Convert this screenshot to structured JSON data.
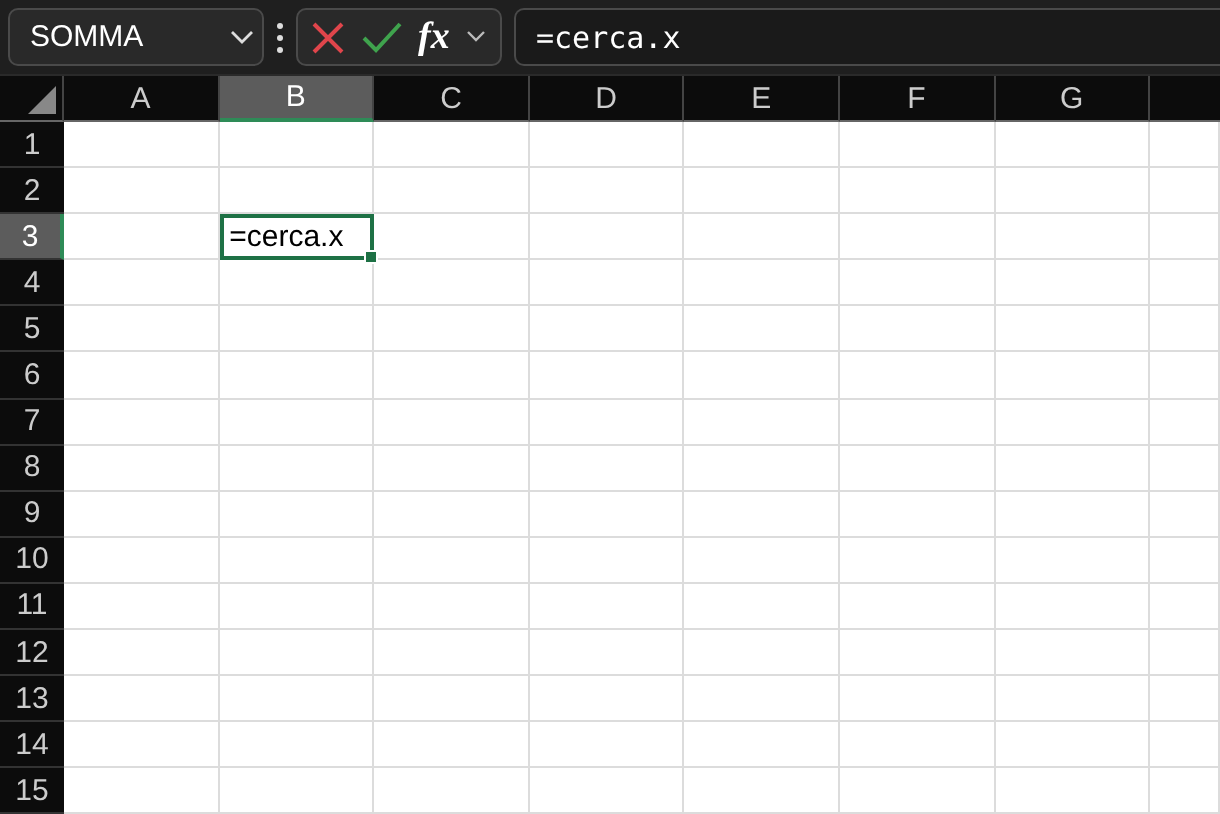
{
  "name_box": {
    "value": "SOMMA"
  },
  "formula_bar": {
    "fx_label": "fx",
    "value": "=cerca.x"
  },
  "columns": [
    {
      "label": "A",
      "selected": false
    },
    {
      "label": "B",
      "selected": true
    },
    {
      "label": "C",
      "selected": false
    },
    {
      "label": "D",
      "selected": false
    },
    {
      "label": "E",
      "selected": false
    },
    {
      "label": "F",
      "selected": false
    },
    {
      "label": "G",
      "selected": false
    }
  ],
  "rows": [
    {
      "label": "1",
      "selected": false
    },
    {
      "label": "2",
      "selected": false
    },
    {
      "label": "3",
      "selected": true
    },
    {
      "label": "4",
      "selected": false
    },
    {
      "label": "5",
      "selected": false
    },
    {
      "label": "6",
      "selected": false
    },
    {
      "label": "7",
      "selected": false
    },
    {
      "label": "8",
      "selected": false
    },
    {
      "label": "9",
      "selected": false
    },
    {
      "label": "10",
      "selected": false
    },
    {
      "label": "11",
      "selected": false
    },
    {
      "label": "12",
      "selected": false
    },
    {
      "label": "13",
      "selected": false
    },
    {
      "label": "14",
      "selected": false
    },
    {
      "label": "15",
      "selected": false
    }
  ],
  "active_cell": {
    "value": "=cerca.x"
  }
}
